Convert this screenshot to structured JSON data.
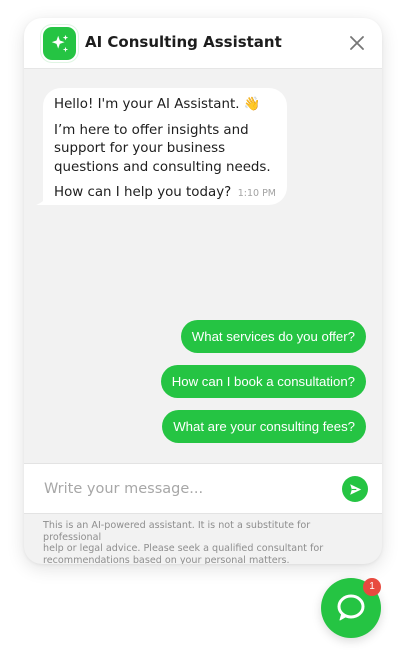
{
  "header": {
    "title": "AI Consulting Assistant",
    "logo_icon": "sparkles-icon",
    "close_icon": "close-icon"
  },
  "bot_message": {
    "greeting": "Hello! I'm your AI Assistant. 👋",
    "intro_line1": "I’m here to offer insights and",
    "intro_line2": "support for your business",
    "intro_line3": "questions and consulting needs.",
    "question": "How can I help you today?",
    "time": "1:10 PM"
  },
  "quick_replies": [
    {
      "label": "What services do you offer?"
    },
    {
      "label": "How can I book a consultation?"
    },
    {
      "label": "What are your consulting fees?"
    }
  ],
  "composer": {
    "placeholder": "Write your message...",
    "send_icon": "send-icon"
  },
  "disclaimer": {
    "line1": "This is an AI-powered assistant. It is not a substitute for professional",
    "line2": "help or legal advice. Please seek a qualified consultant for",
    "line3": "recommendations based on your personal matters."
  },
  "launcher": {
    "icon": "chat-bubble-icon",
    "badge_count": "1"
  },
  "colors": {
    "accent": "#25c443",
    "badge": "#e84a3f",
    "panel_background": "#f2f2f2"
  }
}
